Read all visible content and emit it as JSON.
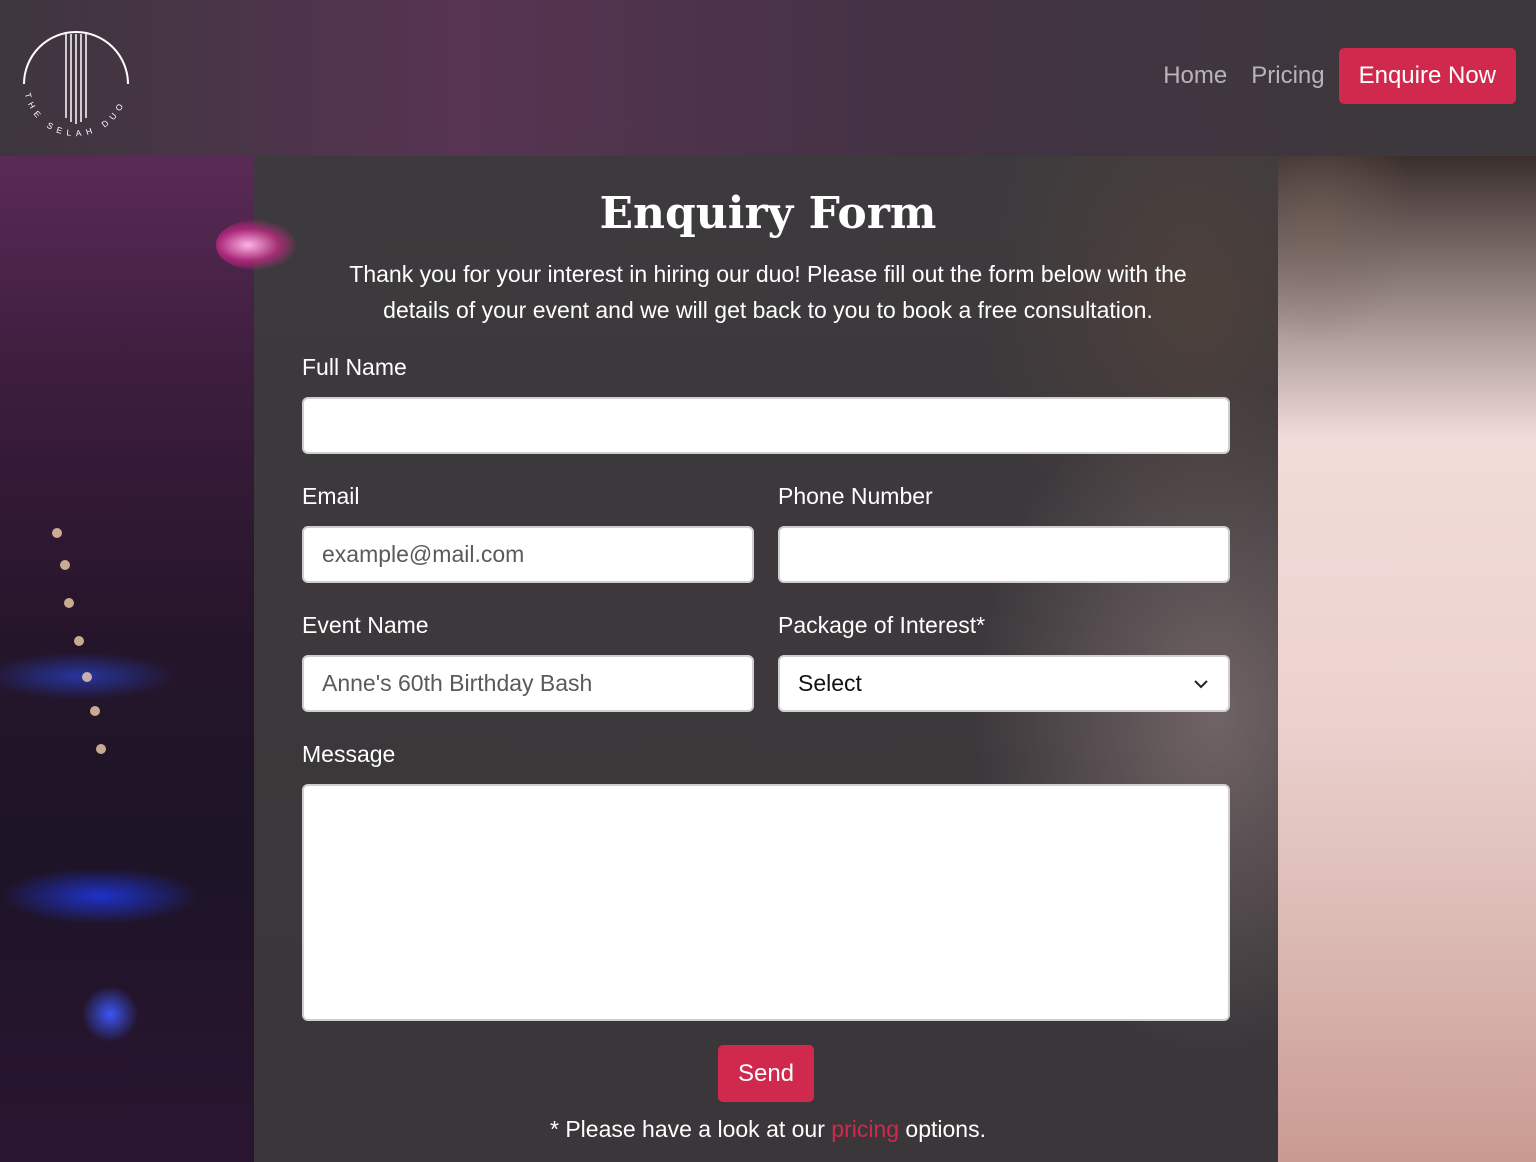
{
  "brand": {
    "logo_text": "THE SELAH DUO"
  },
  "nav": {
    "items": [
      {
        "label": "Home"
      },
      {
        "label": "Pricing"
      }
    ],
    "cta_label": "Enquire Now"
  },
  "form": {
    "title": "Enquiry Form",
    "intro": "Thank you for your interest in hiring our duo! Please fill out the form below with the details of your event and we will get back to you to book a free consultation.",
    "full_name": {
      "label": "Full Name",
      "value": ""
    },
    "email": {
      "label": "Email",
      "placeholder": "example@mail.com"
    },
    "phone": {
      "label": "Phone Number",
      "value": ""
    },
    "event_name": {
      "label": "Event Name",
      "placeholder": "Anne's 60th Birthday Bash"
    },
    "package": {
      "label": "Package of Interest*",
      "selected": "Select"
    },
    "message": {
      "label": "Message",
      "value": ""
    },
    "send_label": "Send",
    "footnote_before": "* Please have a look at our ",
    "footnote_link": "pricing",
    "footnote_after": " options."
  },
  "colors": {
    "accent": "#d1294e",
    "background": "#3b393c"
  }
}
